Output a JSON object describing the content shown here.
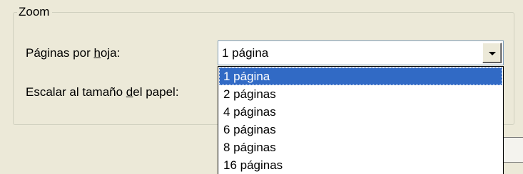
{
  "group": {
    "title": "Zoom"
  },
  "pages_per_sheet": {
    "label_before": "Páginas por ",
    "label_accel": "h",
    "label_after": "oja:",
    "selected": "1 página",
    "options": [
      "1 página",
      "2 páginas",
      "4 páginas",
      "6 páginas",
      "8 páginas",
      "16 páginas"
    ],
    "highlighted_index": 0
  },
  "scale_to_paper": {
    "label_before": "Escalar al tamaño ",
    "label_accel": "d",
    "label_after": "el papel:"
  },
  "icons": {
    "dropdown_arrow": "chevron-down-icon"
  },
  "colors": {
    "dialog_bg": "#ece9d8",
    "highlight": "#316ac5",
    "combo_border": "#7f9db9"
  }
}
